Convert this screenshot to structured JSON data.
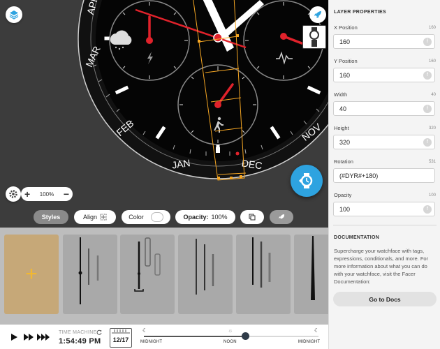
{
  "canvas": {
    "month_labels": [
      "APR",
      "MAR",
      "FEB",
      "JAN",
      "DEC",
      "NOV"
    ],
    "zoom": {
      "value": "100%",
      "plus": "+",
      "minus": "−"
    }
  },
  "toolbar": {
    "styles_label": "Styles",
    "align_label": "Align",
    "color_label": "Color",
    "opacity_label": "Opacity:",
    "opacity_value": "100%"
  },
  "layer_strip": {
    "add_label": "+",
    "tile_count": 5
  },
  "time_machine": {
    "label": "TIME MACHINE",
    "time": "1:54:49 PM",
    "date": "12/17",
    "progress": 0.58,
    "ticks": [
      "MIDNIGHT",
      "NOON",
      "MIDNIGHT"
    ]
  },
  "properties": {
    "title": "LAYER PROPERTIES",
    "fields": [
      {
        "label": "X Position",
        "hint": "160",
        "value": "160"
      },
      {
        "label": "Y Position",
        "hint": "160",
        "value": "160"
      },
      {
        "label": "Width",
        "hint": "40",
        "value": "40"
      },
      {
        "label": "Height",
        "hint": "320",
        "value": "320"
      },
      {
        "label": "Rotation",
        "hint": "531",
        "value": "(#DYR#+180)"
      },
      {
        "label": "Opacity",
        "hint": "100",
        "value": "100"
      }
    ]
  },
  "documentation": {
    "title": "DOCUMENTATION",
    "text": "Supercharge your watchface with tags, expressions, conditionals, and more. For more information about what you can do with your watchface, visit the Facer Documentation:",
    "button_label": "Go to Docs"
  },
  "colors": {
    "accent": "#2ea3e0",
    "canvas_bg": "#3c3c3c",
    "hand_red": "#e0222b",
    "selection": "#f5a623",
    "add_tile": "#c6a878"
  }
}
